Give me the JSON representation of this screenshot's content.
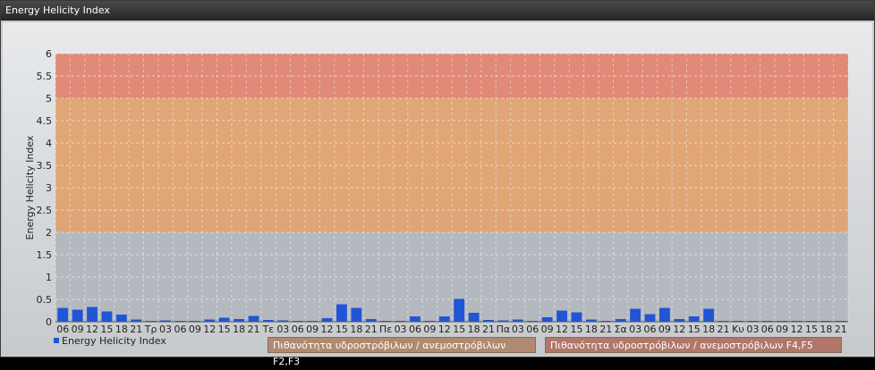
{
  "window": {
    "title": "Energy Helicity Index"
  },
  "colors": {
    "bar": "#1f55d6",
    "band_low": "#b4b9c0",
    "band_f2f3": "#e0a06a",
    "band_f4f5": "#e0806a"
  },
  "legend": {
    "series_label": "Energy Helicity Index",
    "f2f3_label": "Πιθανότητα υδροστρόβιλων / ανεμοστρόβιλων F2,F3",
    "f4f5_label": "Πιθανότητα υδροστρόβιλων / ανεμοστρόβιλων F4,F5"
  },
  "chart_data": {
    "type": "bar",
    "title": "",
    "ylabel": "Energy Helicity Index",
    "ylim": [
      0,
      6
    ],
    "yticks": [
      "0",
      "0.5",
      "1",
      "1.5",
      "2",
      "2.5",
      "3",
      "3.5",
      "4",
      "4.5",
      "5",
      "5.5",
      "6"
    ],
    "bands": [
      {
        "name": "Πιθανότητα υδροστρόβιλων / ανεμοστρόβιλων F2,F3",
        "from": 2,
        "to": 5
      },
      {
        "name": "Πιθανότητα υδροστρόβιλων / ανεμοστρόβιλων F4,F5",
        "from": 5,
        "to": 6
      }
    ],
    "categories": [
      "06",
      "09",
      "12",
      "15",
      "18",
      "21",
      "Τρ",
      "03",
      "06",
      "09",
      "12",
      "15",
      "18",
      "21",
      "Τε",
      "03",
      "06",
      "09",
      "12",
      "15",
      "18",
      "21",
      "Πε",
      "03",
      "06",
      "09",
      "12",
      "15",
      "18",
      "21",
      "Πα",
      "03",
      "06",
      "09",
      "12",
      "15",
      "18",
      "21",
      "Σα",
      "03",
      "06",
      "09",
      "12",
      "15",
      "18",
      "21",
      "Κυ",
      "03",
      "06",
      "09",
      "12",
      "15",
      "18",
      "21"
    ],
    "series": [
      {
        "name": "Energy Helicity Index",
        "values": [
          0.31,
          0.27,
          0.33,
          0.23,
          0.16,
          0.05,
          0.02,
          0.03,
          0.02,
          0.02,
          0.05,
          0.09,
          0.06,
          0.13,
          0.04,
          0.03,
          0.02,
          0.02,
          0.08,
          0.39,
          0.31,
          0.06,
          0.02,
          0.02,
          0.12,
          0.02,
          0.12,
          0.51,
          0.2,
          0.04,
          0.03,
          0.05,
          0.02,
          0.1,
          0.25,
          0.21,
          0.05,
          0.02,
          0.06,
          0.29,
          0.17,
          0.31,
          0.06,
          0.12,
          0.29,
          0.02,
          0.02,
          0.02,
          0.02,
          0.02,
          0.02,
          0.02,
          0.02,
          0.02
        ]
      }
    ]
  }
}
